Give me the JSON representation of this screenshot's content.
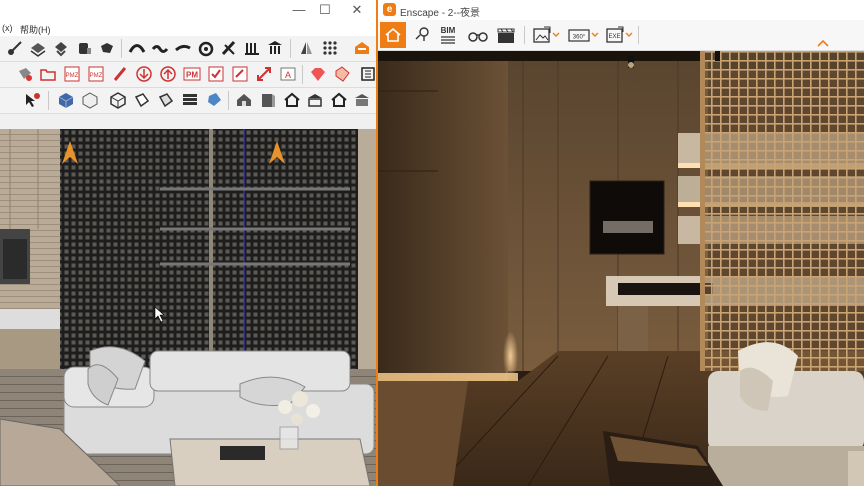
{
  "sketchup": {
    "menu": {
      "partial_item": "(x)",
      "help_item": "帮助(H)"
    },
    "window_controls": {
      "minimize": "—",
      "maximize": "☐",
      "close": "✕"
    },
    "toolbar_row1_icons": [
      "follow-me-icon",
      "push-pull-icon",
      "offset-icon",
      "paint-bucket-icon",
      "arc-icon",
      "curve-icon",
      "bezier-icon",
      "spiral-icon",
      "knife-icon",
      "shape-bender-icon",
      "column-icon",
      "pyramid-icon",
      "grid-icon",
      "enscape-logo-icon"
    ],
    "toolbar_row2_icons": [
      "eraser-icon",
      "folder-open-icon",
      "pmz-export-icon",
      "pmz-import-icon",
      "pencil-icon",
      "circle-arrow-down-icon",
      "circle-arrow-up-icon",
      "pm-icon",
      "checkbox-icon",
      "scale-icon",
      "text-box-icon",
      "gem-icon",
      "badge-icon",
      "panel-icon"
    ],
    "toolbar_row3_icons": [
      "select-pointer-icon",
      "cube-blue-icon",
      "cube-outline-icon",
      "box-open-icon",
      "face-icon",
      "material-icon",
      "stack-icon",
      "house-icon",
      "door-icon",
      "home-icon",
      "store-icon",
      "roof-icon",
      "building-icon"
    ],
    "pm_label": "PM"
  },
  "enscape": {
    "title": "Enscape - 2--夜景",
    "logo_letter": "e",
    "toolbar": {
      "bim_label": "BIM",
      "items": [
        "home-icon",
        "location-pin-icon",
        "bim-list-icon",
        "binoculars-icon",
        "clapperboard-icon",
        "export-image-icon",
        "export-360-icon",
        "export-exe-icon"
      ],
      "exe_label": "EXE",
      "pano_label": "360°"
    },
    "collapse_icon": "chevron-up-icon",
    "accent_color": "#ef7d16"
  }
}
